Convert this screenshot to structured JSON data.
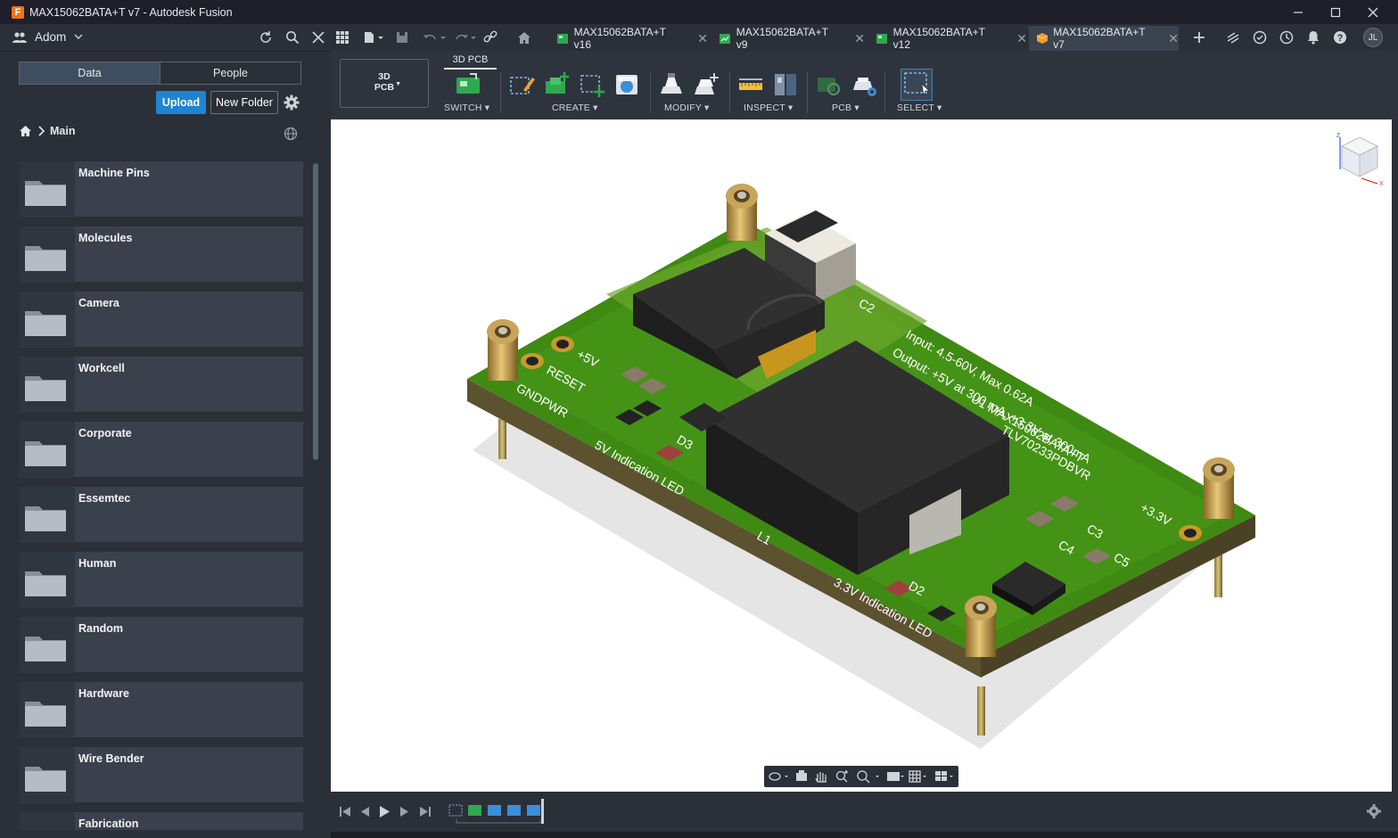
{
  "window": {
    "title": "MAX15062BATA+T v7 - Autodesk Fusion",
    "app_icon": "fusion-logo-icon"
  },
  "team": {
    "name": "Adom"
  },
  "tabs": [
    {
      "label": "MAX15062BATA+T v16",
      "icon": "pcb-icon"
    },
    {
      "label": "MAX15062BATA+T v9",
      "icon": "schematic-icon"
    },
    {
      "label": "MAX15062BATA+T v12",
      "icon": "pcb-icon"
    },
    {
      "label": "MAX15062BATA+T v7",
      "icon": "3d-pcb-icon",
      "active": true
    }
  ],
  "user": {
    "initials": "JL"
  },
  "data_panel": {
    "segments": [
      "Data",
      "People"
    ],
    "upload_label": "Upload",
    "new_folder_label": "New Folder",
    "breadcrumb": "Main",
    "folders": [
      "Machine Pins",
      "Molecules",
      "Camera",
      "Workcell",
      "Corporate",
      "Essemtec",
      "Human",
      "Random",
      "Hardware",
      "Wire Bender",
      "Fabrication"
    ]
  },
  "toolbar": {
    "workspace_label_1": "3D",
    "workspace_label_2": "PCB",
    "tab": "3D PCB",
    "groups": [
      "SWITCH",
      "CREATE",
      "MODIFY",
      "INSPECT",
      "PCB",
      "SELECT"
    ]
  },
  "board": {
    "silkscreen": {
      "input": "Input: 4.5-60V, Max 0.62A",
      "output": "Output: +5V at 300 mA, +3.3V at 300mA",
      "u1": "U1 MAX15062BATA+T",
      "u2": "TLV70233PDBVR",
      "plus5v": "+5V",
      "reset": "RESET",
      "gndpwr": "GNDPWR",
      "led5": "5V Indication LED",
      "led33": "3.3V Indication LED",
      "plus33": "+3.3V",
      "c2": "C2",
      "c3": "C3",
      "c4": "C4",
      "c5": "C5",
      "d2": "D2",
      "d3": "D3",
      "l1": "L1"
    }
  },
  "colors": {
    "accent": "#1d85d3",
    "board": "#3f8a12",
    "board_edge": "#5c5230"
  }
}
